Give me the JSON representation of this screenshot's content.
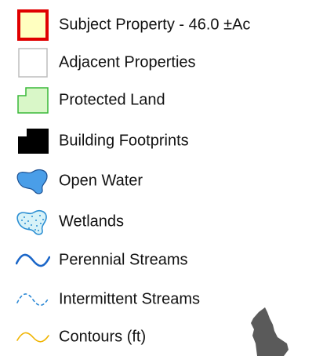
{
  "legend": {
    "items": [
      {
        "label": "Subject Property - 46.0 ±Ac",
        "icon": "subject-property-swatch",
        "fill": "#ffffc0",
        "stroke": "#e00000"
      },
      {
        "label": "Adjacent Properties",
        "icon": "adjacent-properties-swatch",
        "fill": "#ffffff",
        "stroke": "#bdbdbd"
      },
      {
        "label": "Protected Land",
        "icon": "protected-land-swatch",
        "fill": "#d9f7c8",
        "stroke": "#38b838"
      },
      {
        "label": "Building Footprints",
        "icon": "building-footprint-icon",
        "fill": "#000000"
      },
      {
        "label": "Open Water",
        "icon": "open-water-icon",
        "fill": "#4a9ee8",
        "stroke": "#1b4f91"
      },
      {
        "label": "Wetlands",
        "icon": "wetlands-icon",
        "fill": "#d7f2f8",
        "stroke": "#2c8fd3"
      },
      {
        "label": "Perennial Streams",
        "icon": "perennial-stream-icon",
        "stroke": "#1b66c8"
      },
      {
        "label": "Intermittent Streams",
        "icon": "intermittent-stream-icon",
        "stroke": "#2e8ad6"
      },
      {
        "label": "Contours (ft)",
        "icon": "contour-line-icon",
        "stroke": "#f0b400"
      }
    ]
  },
  "locator_map": {
    "icon": "new-hampshire-locator-icon",
    "fill": "#5a5a5a"
  }
}
